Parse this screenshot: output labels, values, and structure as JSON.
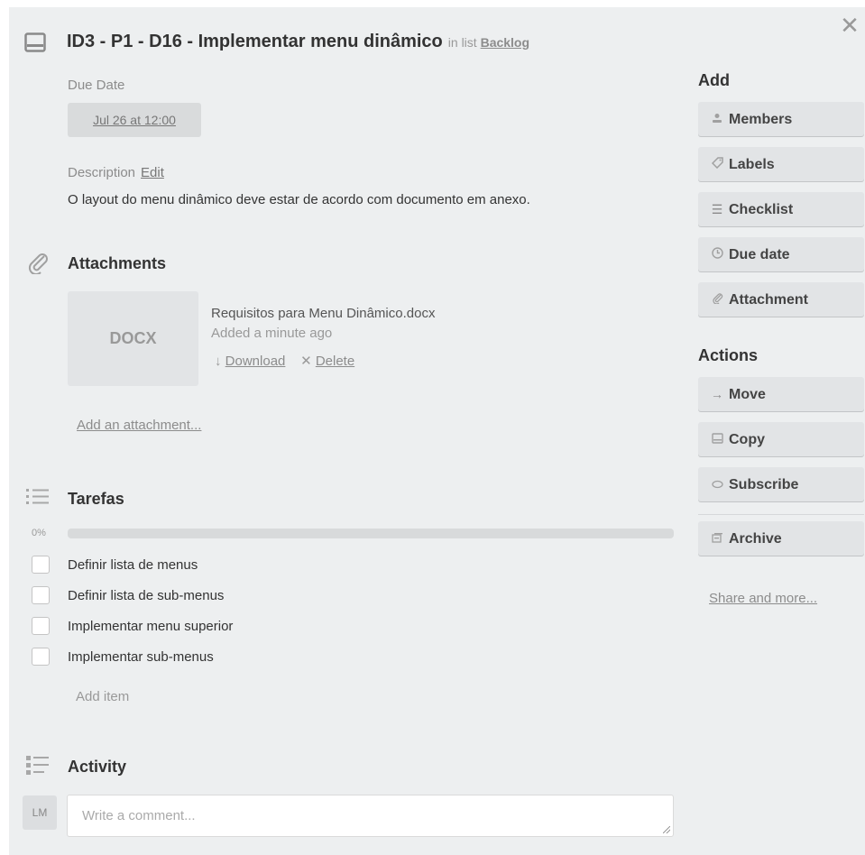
{
  "card": {
    "title": "ID3 - P1 - D16 - Implementar menu dinâmico",
    "in_list_prefix": "in list",
    "list_name": "Backlog"
  },
  "due_date": {
    "label": "Due Date",
    "value": "Jul 26 at 12:00"
  },
  "description": {
    "label": "Description",
    "edit_label": "Edit",
    "text": "O layout do menu dinâmico deve estar de acordo com documento em anexo."
  },
  "attachments": {
    "heading": "Attachments",
    "items": [
      {
        "thumb_label": "DOCX",
        "name": "Requisitos para Menu Dinâmico.docx",
        "meta": "Added a minute ago",
        "download_label": "Download",
        "delete_label": "Delete"
      }
    ],
    "add_label": "Add an attachment..."
  },
  "checklist": {
    "heading": "Tarefas",
    "progress_percent_label": "0%",
    "progress_fraction": 0,
    "items": [
      {
        "label": "Definir lista de menus",
        "checked": false
      },
      {
        "label": "Definir lista de sub-menus",
        "checked": false
      },
      {
        "label": "Implementar menu superior",
        "checked": false
      },
      {
        "label": "Implementar sub-menus",
        "checked": false
      }
    ],
    "add_item_label": "Add item"
  },
  "activity": {
    "heading": "Activity",
    "avatar_initials": "LM",
    "comment_placeholder": "Write a comment..."
  },
  "sidebar": {
    "add_heading": "Add",
    "add_buttons": [
      {
        "label": "Members",
        "icon": "person-icon"
      },
      {
        "label": "Labels",
        "icon": "tag-icon"
      },
      {
        "label": "Checklist",
        "icon": "list-icon"
      },
      {
        "label": "Due date",
        "icon": "clock-icon"
      },
      {
        "label": "Attachment",
        "icon": "paperclip-icon"
      }
    ],
    "actions_heading": "Actions",
    "action_buttons": [
      {
        "label": "Move",
        "icon": "arrow-right-icon"
      },
      {
        "label": "Copy",
        "icon": "card-icon"
      },
      {
        "label": "Subscribe",
        "icon": "eye-icon"
      },
      {
        "label": "Archive",
        "icon": "archive-icon"
      }
    ],
    "share_label": "Share and more..."
  },
  "colors": {
    "window_bg": "#edeff0",
    "button_bg": "#e2e4e6",
    "progress_track": "#d8dadb"
  }
}
